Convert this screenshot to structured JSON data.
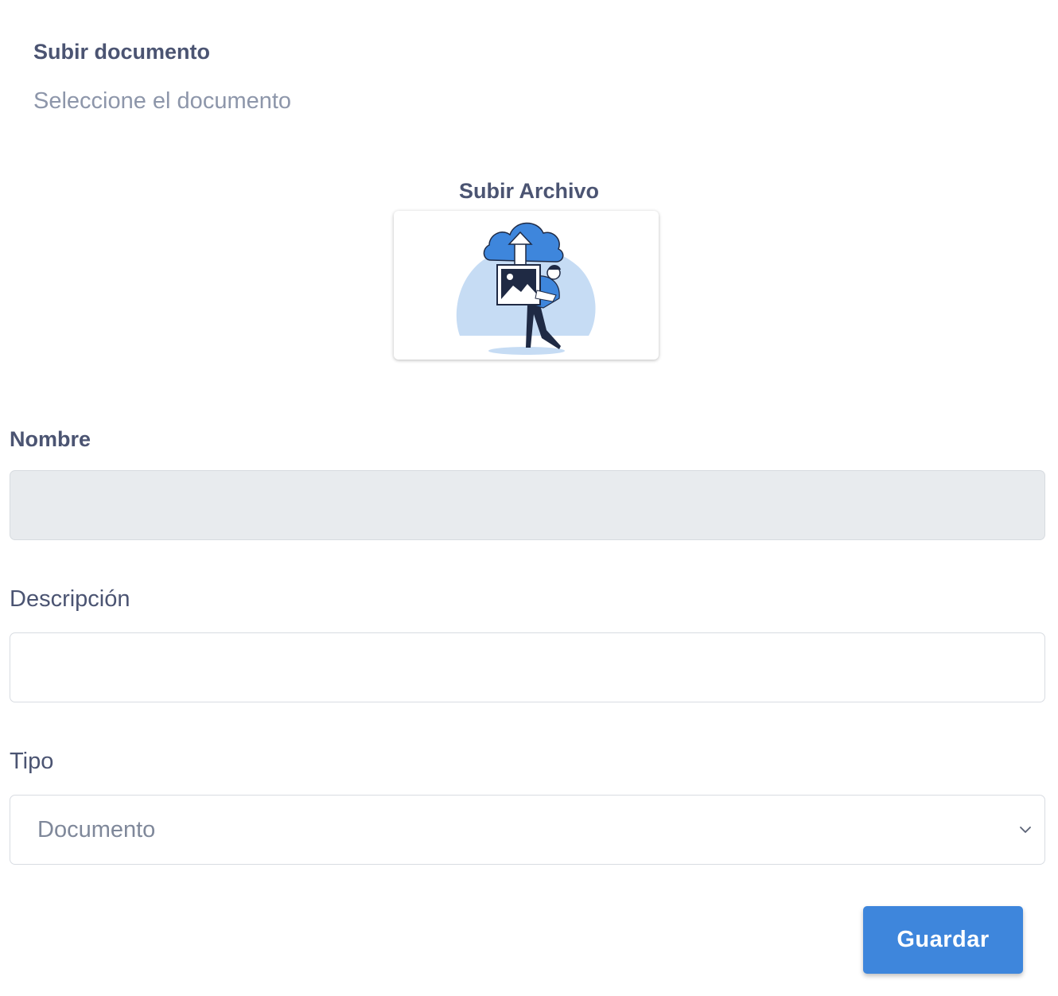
{
  "header": {
    "title": "Subir documento",
    "subtitle": "Seleccione el documento"
  },
  "upload": {
    "label": "Subir Archivo",
    "icon": "cloud-upload-illustration",
    "accent_color": "#3e86dc",
    "blob_color": "#c6dcf4"
  },
  "form": {
    "nombre": {
      "label": "Nombre",
      "value": "",
      "disabled": true
    },
    "descripcion": {
      "label": "Descripción",
      "value": ""
    },
    "tipo": {
      "label": "Tipo",
      "selected": "Documento"
    }
  },
  "actions": {
    "save_label": "Guardar",
    "save_color": "#3e86dc"
  }
}
